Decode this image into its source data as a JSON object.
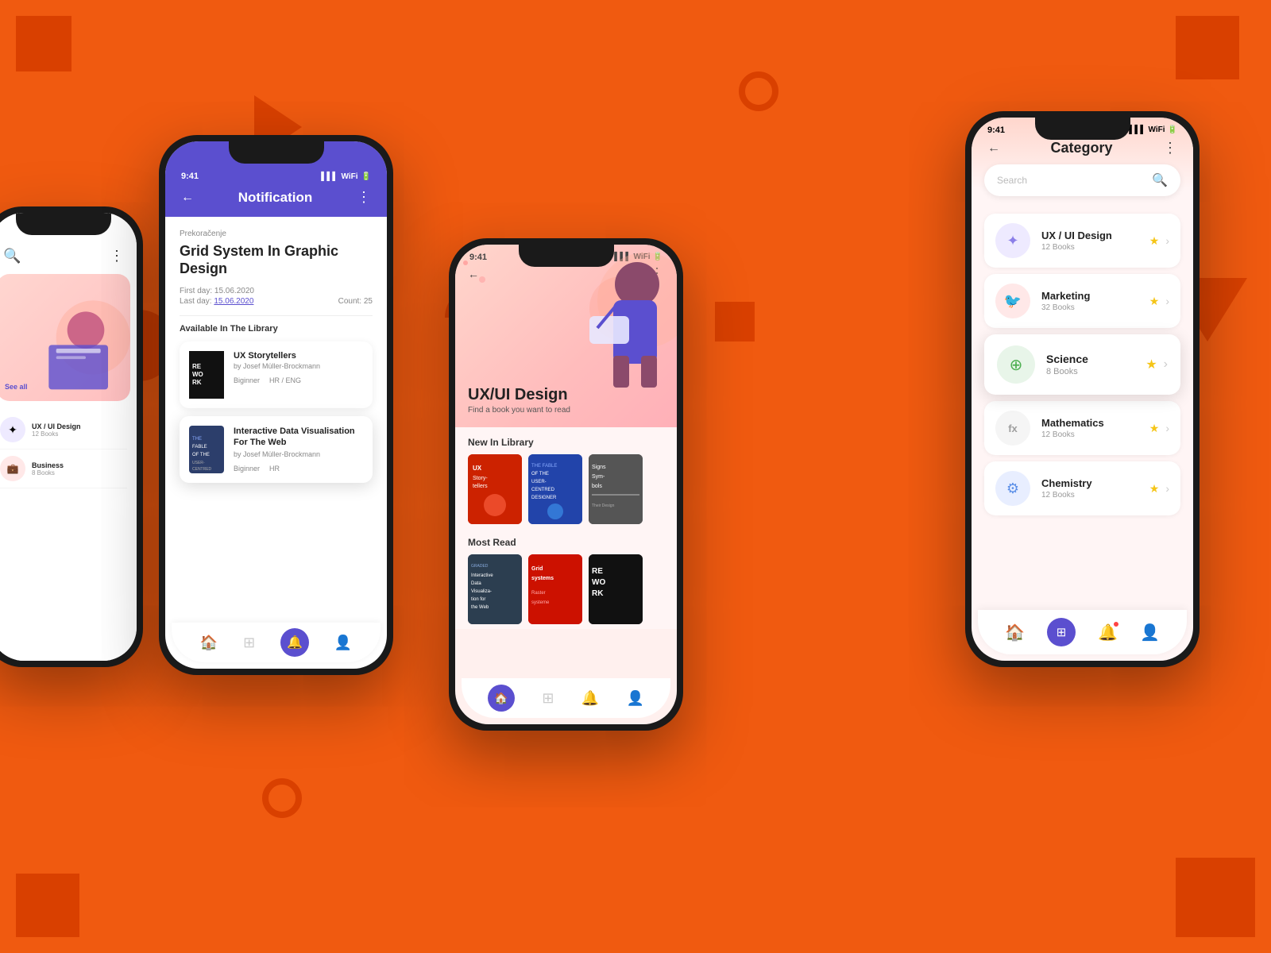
{
  "background": "#F05A10",
  "phone1": {
    "categories": [
      {
        "name": "UX / UI Design",
        "count": "12 Books",
        "color": "#E8E8F8",
        "iconColor": "#5B4FCF"
      },
      {
        "name": "Business",
        "count": "8 Books",
        "color": "#FFE8E8",
        "iconColor": "#E55"
      },
      {
        "name": "See all",
        "isLink": true
      }
    ]
  },
  "phone2": {
    "statusTime": "9:41",
    "title": "Notification",
    "sectionLabel": "Prekoračenje",
    "bookTitle": "Grid System In Graphic Design",
    "firstDay": "First day:  15.06.2020",
    "lastDay": "Last day:",
    "lastDayValue": "15.06.2020",
    "count": "Count:",
    "countValue": "25",
    "availableTitle": "Available In The Library",
    "books": [
      {
        "title": "UX Storytellers",
        "author": "by Josef Müller-Brockmann",
        "level": "Biginner",
        "lang": "HR / ENG",
        "coverBg": "#111"
      },
      {
        "title": "Interactive Data Visualisation For The Web",
        "author": "by Josef Müller-Brockmann",
        "level": "Biginner",
        "lang": "HR",
        "coverBg": "#2c3e6b"
      }
    ],
    "nav": [
      "home",
      "grid",
      "bell",
      "user"
    ]
  },
  "phone3": {
    "statusTime": "9:41",
    "heroTitle": "UX/UI Design",
    "heroSub": "Find a book you want to read",
    "newInLibrary": "New In Library",
    "mostRead": "Most Read",
    "books": [
      {
        "title": "UX Storytellers",
        "color": "#cc2200"
      },
      {
        "title": "The Fable of User-Centred Designer",
        "color": "#2244aa"
      },
      {
        "title": "Signs Sym",
        "color": "#444"
      }
    ],
    "mostReadBooks": [
      {
        "title": "Interactive Data Visualization for the Web",
        "color": "#2c3e50"
      },
      {
        "title": "Grid Systems",
        "color": "#cc1100"
      },
      {
        "title": "Rework",
        "color": "#111"
      }
    ],
    "nav": [
      "home",
      "grid",
      "bell",
      "user"
    ]
  },
  "phone4": {
    "statusTime": "9:41",
    "title": "Category",
    "searchPlaceholder": "Search",
    "categories": [
      {
        "name": "UX / UI Design",
        "count": "12 Books",
        "iconColor": "#8B7FE8",
        "iconBg": "#EEEAFF",
        "icon": "✦"
      },
      {
        "name": "Marketing",
        "count": "32 Books",
        "iconColor": "#FF6B6B",
        "iconBg": "#FFE8E8",
        "icon": "🐦"
      },
      {
        "name": "Science",
        "count": "8 Books",
        "iconColor": "#4CAF50",
        "iconBg": "#E8F5E9",
        "icon": "⊕",
        "active": true
      },
      {
        "name": "Mathematics",
        "count": "12 Books",
        "iconColor": "#9E9E9E",
        "iconBg": "#F5F5F5",
        "icon": "fx"
      },
      {
        "name": "Chemistry",
        "count": "12 Books",
        "iconColor": "#5B8FE8",
        "iconBg": "#E8EEFF",
        "icon": "⚙"
      }
    ],
    "nav": [
      "home",
      "grid",
      "bell",
      "user"
    ]
  }
}
